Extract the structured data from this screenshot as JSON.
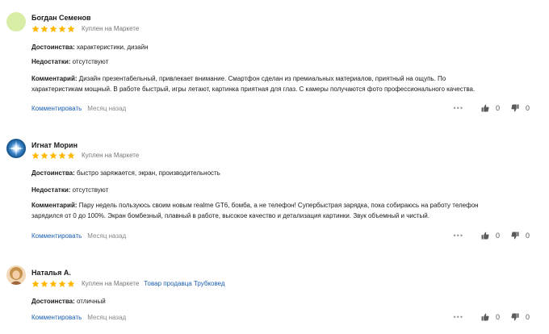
{
  "colors": {
    "star": "#ffb700",
    "link": "#1a5fb4",
    "muted": "#888888"
  },
  "labels": {
    "pros": "Достоинства:",
    "cons": "Недостатки:",
    "comment": "Комментарий:",
    "reply": "Комментировать",
    "more": "•••"
  },
  "reviews": [
    {
      "author": "Богдан Семенов",
      "rating": 5,
      "purchase": "Куплен на Маркете",
      "pros": "характеристики, дизайн",
      "cons": "отсутствуют",
      "comment_line1": "Дизайн презентабельный, привлекает внимание. Смартфон сделан из премиальных материалов, приятный на ощупь. По",
      "comment_line2": "характеристикам мощный. В работе быстрый, игры летают, картинка приятная для глаз. С камеры получаются фото профессионального качества.",
      "date": "Месяц назад",
      "likes": "0",
      "dislikes": "0",
      "avatar_icon": "avatar-placeholder-icon"
    },
    {
      "author": "Игнат Морин",
      "rating": 5,
      "purchase": "Куплен на Маркете",
      "pros": "быстро заряжается, экран, производительность",
      "cons": "отсутствуют",
      "comment_line1": "Пару недель пользуюсь своим новым realme GT6, бомба, а не телефон! Супербыстрая зарядка, пока собираюсь на работу телефон",
      "comment_line2": "зарядился от 0 до 100%. Экран бомбезный, плавный в работе, высокое качество и детализация картинки. Звук объемный и чистый.",
      "date": "Месяц назад",
      "likes": "0",
      "dislikes": "0",
      "avatar_icon": "star-avatar-icon"
    },
    {
      "author": "Наталья А.",
      "rating": 5,
      "purchase": "Куплен на Маркете",
      "seller": "Товар продавца Трубковед",
      "pros": "отличный",
      "date": "Месяц назад",
      "likes": "0",
      "dislikes": "0",
      "avatar_icon": "user-photo-avatar-icon"
    }
  ]
}
